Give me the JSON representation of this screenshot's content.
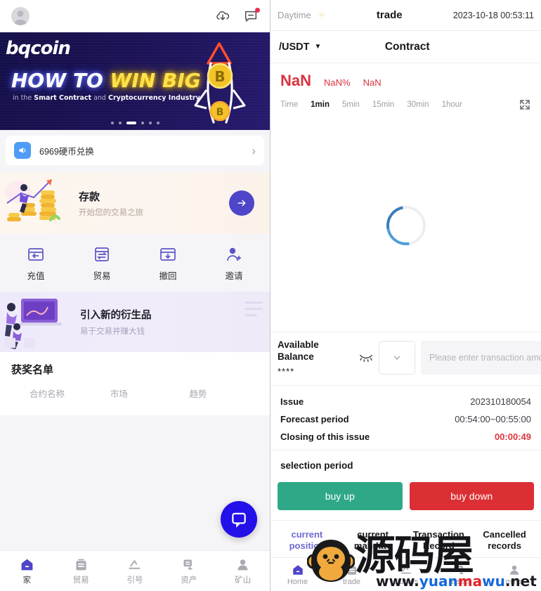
{
  "left": {
    "topbar": {
      "avatar_name": "avatar",
      "download_icon": "cloud-download-icon",
      "message_icon": "chat-message-icon"
    },
    "banner": {
      "logo": "bqcoin",
      "headline_part1": "HOW TO ",
      "headline_part2": "WIN BIG",
      "sub_dim1": "in the ",
      "sub_hl1": "Smart Contract",
      "sub_dim2": " and ",
      "sub_hl2": "Cryptocurrency Industry",
      "dot_count": 6,
      "active_dot_index": 2
    },
    "notice": {
      "icon": "speaker-icon",
      "text": "6969硬币兑换",
      "chevron": "›"
    },
    "deposit": {
      "title": "存款",
      "subtitle": "开始您的交易之旅",
      "arrow_icon": "arrow-right-icon"
    },
    "quick_actions": [
      {
        "label": "充值",
        "icon": "recharge-icon"
      },
      {
        "label": "贸易",
        "icon": "trade-exchange-icon"
      },
      {
        "label": "撤回",
        "icon": "withdraw-icon"
      },
      {
        "label": "邀请",
        "icon": "invite-user-icon"
      }
    ],
    "derivative": {
      "title": "引入新的衍生品",
      "subtitle": "易于交易并赚大钱"
    },
    "winners": {
      "title": "获奖名单",
      "columns": [
        "合约名称",
        "市场",
        "趋势"
      ],
      "rows": []
    },
    "fab": {
      "icon": "chat-bubble-icon"
    },
    "bottom_nav": [
      {
        "label": "家",
        "icon": "home-icon",
        "active": true
      },
      {
        "label": "贸易",
        "icon": "trade-icon",
        "active": false
      },
      {
        "label": "引号",
        "icon": "quotes-icon",
        "active": false
      },
      {
        "label": "资产",
        "icon": "assets-icon",
        "active": false
      },
      {
        "label": "矿山",
        "icon": "mine-user-icon",
        "active": false
      }
    ]
  },
  "right": {
    "topbar": {
      "daytime_label": "Daytime",
      "sun_icon": "sun-icon",
      "title": "trade",
      "clock": "2023-10-18 00:53:11"
    },
    "subbar": {
      "pair": "/USDT",
      "caret_icon": "chevron-down-icon",
      "contract_label": "Contract"
    },
    "price": {
      "main": "NaN",
      "percent": "NaN%",
      "amount": "NaN"
    },
    "timeframes": [
      {
        "label": "Time",
        "active": false
      },
      {
        "label": "1min",
        "active": true
      },
      {
        "label": "5min",
        "active": false
      },
      {
        "label": "15min",
        "active": false
      },
      {
        "label": "30min",
        "active": false
      },
      {
        "label": "1hour",
        "active": false
      }
    ],
    "expand_icon": "fullscreen-expand-icon",
    "chart": {
      "state": "loading",
      "spinner_icon": "loading-spinner-icon"
    },
    "balance": {
      "title": "Available Balance",
      "value": "****",
      "eye_icon": "eye-off-icon",
      "dropdown_icon": "chevron-down-icon",
      "input_value": "",
      "input_placeholder": "Please enter transaction amount",
      "clear_icon": "backspace-clear-icon"
    },
    "issue_info": [
      {
        "key": "Issue",
        "value": "202310180054",
        "highlight": false
      },
      {
        "key": "Forecast period",
        "value": "00:54:00~00:55:00",
        "highlight": false
      },
      {
        "key": "Closing of this issue",
        "value": "00:00:49",
        "highlight": true
      }
    ],
    "selection_period_label": "selection period",
    "bet_buttons": {
      "up_label": "buy up",
      "down_label": "buy down",
      "up_color": "#2fa888",
      "down_color": "#dc2f34"
    },
    "record_tabs": [
      {
        "label": "current position",
        "active": true
      },
      {
        "label": "current mandate",
        "active": false
      },
      {
        "label": "Transaction Record",
        "active": false
      },
      {
        "label": "Cancelled records",
        "active": false
      }
    ],
    "bottom_nav": [
      {
        "label": "Home",
        "icon": "home-icon",
        "active": true
      },
      {
        "label": "trade",
        "icon": "trade-icon",
        "active": false
      },
      {
        "label": "Quotes",
        "icon": "quotes-icon",
        "active": false
      },
      {
        "label": "assets",
        "icon": "assets-icon",
        "active": false
      },
      {
        "label": "mine",
        "icon": "mine-user-icon",
        "active": false
      }
    ],
    "watermark": {
      "logo_icon": "monkey-logo-icon",
      "cn_text": "源码屋",
      "url_prefix": "www.",
      "url_yuan": "yuan",
      "url_ma": "ma",
      "url_wu": "wu",
      "url_suffix": ".net"
    }
  }
}
